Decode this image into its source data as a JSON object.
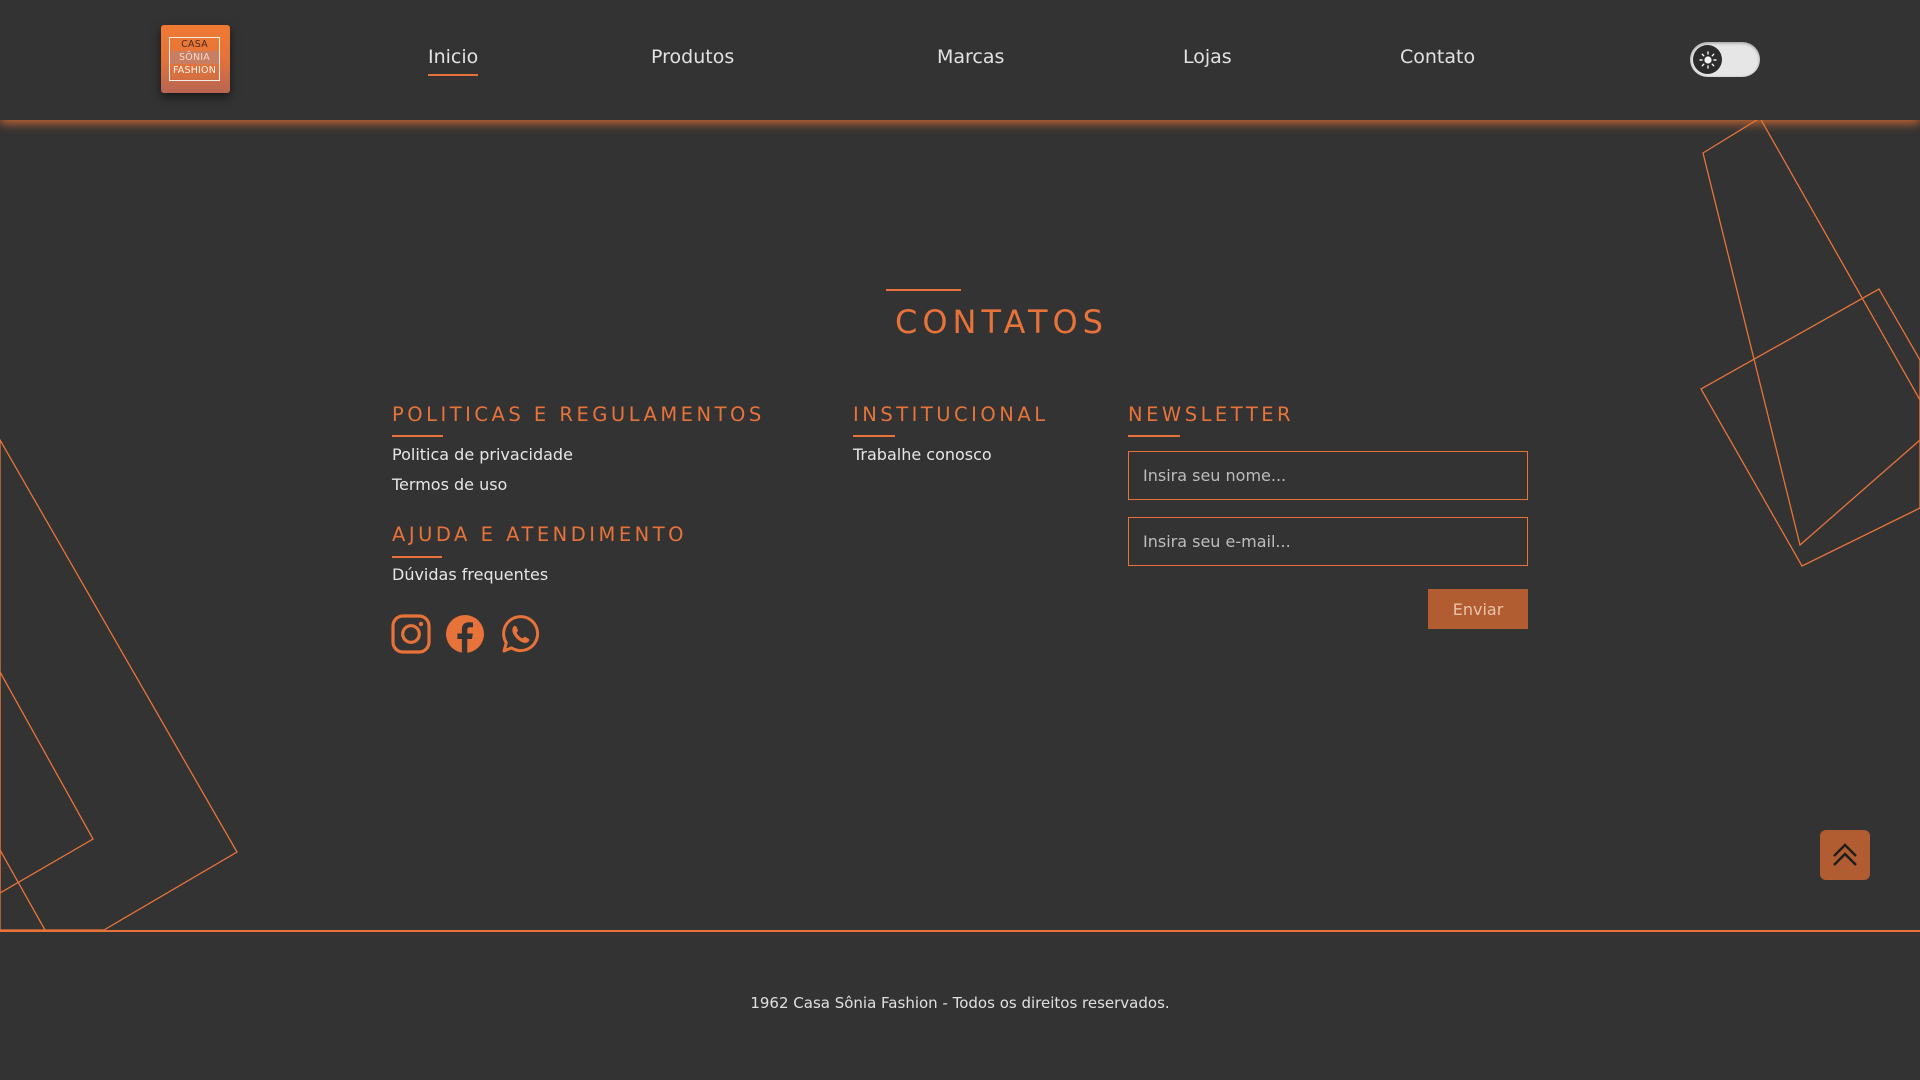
{
  "brand": {
    "logo_lines": [
      "CASA",
      "SÔNIA",
      "FASHION"
    ],
    "accent_color": "#e7733a",
    "background_color": "#333333"
  },
  "nav": {
    "items": [
      {
        "label": "Inicio",
        "active": true
      },
      {
        "label": "Produtos",
        "active": false
      },
      {
        "label": "Marcas",
        "active": false
      },
      {
        "label": "Lojas",
        "active": false
      },
      {
        "label": "Contato",
        "active": false
      }
    ],
    "theme_toggle_icon": "sun-icon"
  },
  "main": {
    "title": "CONTATOS",
    "policies": {
      "title": "POLITICAS E REGULAMENTOS",
      "links": [
        "Politica de privacidade",
        "Termos de uso"
      ]
    },
    "help": {
      "title": "AJUDA E ATENDIMENTO",
      "links": [
        "Dúvidas frequentes"
      ]
    },
    "institutional": {
      "title": "INSTITUCIONAL",
      "links": [
        "Trabalhe conosco"
      ]
    },
    "newsletter": {
      "title": "NEWSLETTER",
      "name_placeholder": "Insira seu nome...",
      "email_placeholder": "Insira seu e-mail...",
      "submit_label": "Enviar"
    },
    "social_icons": [
      "instagram-icon",
      "facebook-icon",
      "whatsapp-icon"
    ]
  },
  "scroll_top_icon": "double-chevron-up-icon",
  "footer": {
    "copyright": "1962 Casa Sônia Fashion - Todos os direitos reservados."
  }
}
